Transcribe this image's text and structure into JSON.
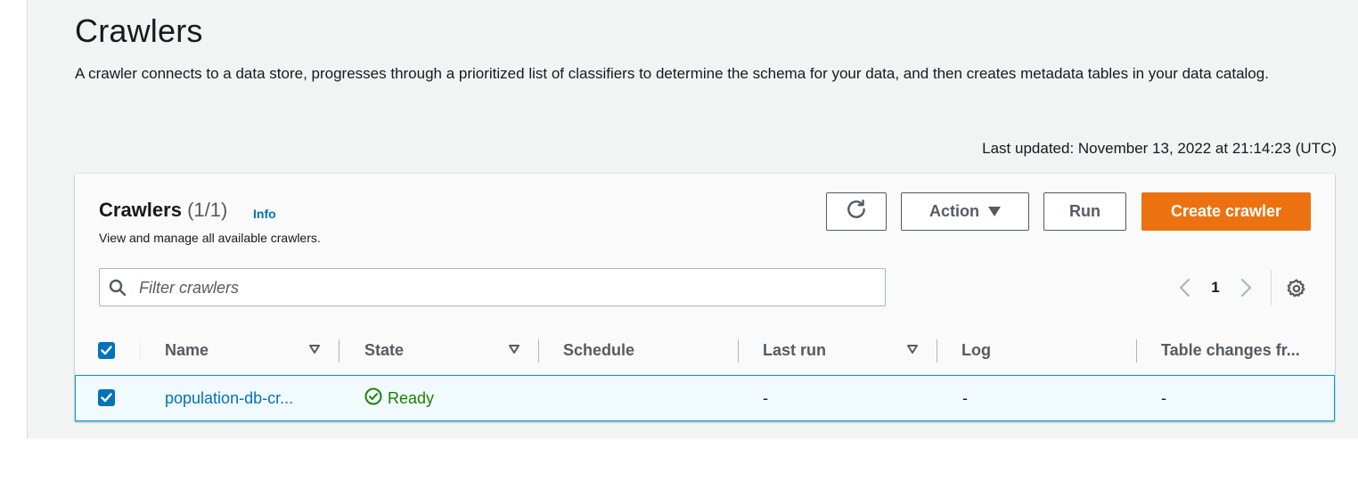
{
  "page": {
    "title": "Crawlers",
    "description": "A crawler connects to a data store, progresses through a prioritized list of classifiers to determine the schema for your data, and then creates metadata tables in your data catalog.",
    "last_updated": "Last updated: November 13, 2022 at 21:14:23 (UTC)"
  },
  "panel": {
    "title": "Crawlers",
    "count": "(1/1)",
    "info_label": "Info",
    "description": "View and manage all available crawlers.",
    "buttons": {
      "refresh_icon": "refresh-icon",
      "action_label": "Action",
      "run_label": "Run",
      "create_label": "Create crawler"
    },
    "filter": {
      "placeholder": "Filter crawlers",
      "value": ""
    },
    "pagination": {
      "current_page": "1"
    }
  },
  "table": {
    "columns": [
      "Name",
      "State",
      "Schedule",
      "Last run",
      "Log",
      "Table changes fr..."
    ],
    "rows": [
      {
        "selected": true,
        "name": "population-db-cr...",
        "state": "Ready",
        "schedule": "",
        "last_run": "-",
        "log": "-",
        "table_changes": "-"
      }
    ]
  },
  "colors": {
    "primary_button": "#ec7211",
    "link": "#0073bb",
    "success": "#1d8102",
    "selected_row_border": "#00a1c9",
    "selected_row_bg": "#f1faff"
  }
}
